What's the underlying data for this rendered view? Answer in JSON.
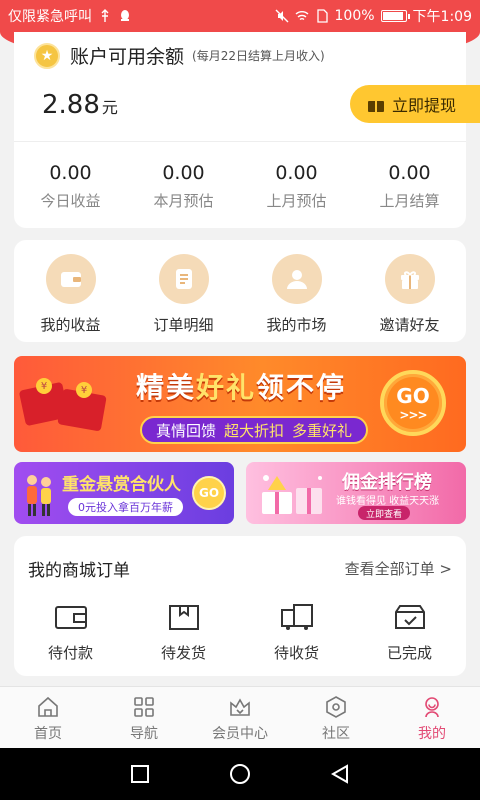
{
  "status_bar": {
    "carrier": "仅限紧急呼叫",
    "battery": "100%",
    "battery_level": 1.0,
    "time": "下午1:09"
  },
  "balance": {
    "title": "账户可用余额",
    "note": "(每月22日结算上月收入)",
    "amount": "2.88",
    "unit": "元",
    "withdraw_label": "立即提现",
    "stats": [
      {
        "value": "0.00",
        "label": "今日收益"
      },
      {
        "value": "0.00",
        "label": "本月预估"
      },
      {
        "value": "0.00",
        "label": "上月预估"
      },
      {
        "value": "0.00",
        "label": "上月结算"
      }
    ]
  },
  "menu": {
    "items": [
      {
        "label": "我的收益",
        "icon": "wallet-icon"
      },
      {
        "label": "订单明细",
        "icon": "list-icon"
      },
      {
        "label": "我的市场",
        "icon": "users-icon"
      },
      {
        "label": "邀请好友",
        "icon": "gift-icon"
      }
    ]
  },
  "banners": {
    "main": {
      "title_a": "精美",
      "title_b": "好礼",
      "title_c": "领不停",
      "sub_a": "真情回馈",
      "sub_b": "超大折扣",
      "sub_c": "多重好礼",
      "go": "GO"
    },
    "left": {
      "title": "重金悬赏合伙人",
      "sub": "0元投入拿百万年薪",
      "go": "GO"
    },
    "right": {
      "title": "佣金排行榜",
      "sub": "谁钱看得见 收益天天涨",
      "button": "立即查看"
    }
  },
  "orders": {
    "title": "我的商城订单",
    "view_all": "查看全部订单 >",
    "items": [
      {
        "label": "待付款",
        "icon": "wallet-outline-icon"
      },
      {
        "label": "待发货",
        "icon": "box-icon"
      },
      {
        "label": "待收货",
        "icon": "truck-icon"
      },
      {
        "label": "已完成",
        "icon": "done-box-icon"
      }
    ]
  },
  "bottom_nav": {
    "items": [
      {
        "label": "首页",
        "icon": "home-icon"
      },
      {
        "label": "导航",
        "icon": "grid-icon"
      },
      {
        "label": "会员中心",
        "icon": "crown-icon"
      },
      {
        "label": "社区",
        "icon": "hexagon-icon"
      },
      {
        "label": "我的",
        "icon": "profile-icon"
      }
    ],
    "active_index": 4,
    "active_color": "#e24a74"
  },
  "colors": {
    "brand_red": "#f04a4a",
    "accent_yellow": "#ffc730",
    "menu_icon_bg": "#f5dbb8"
  }
}
